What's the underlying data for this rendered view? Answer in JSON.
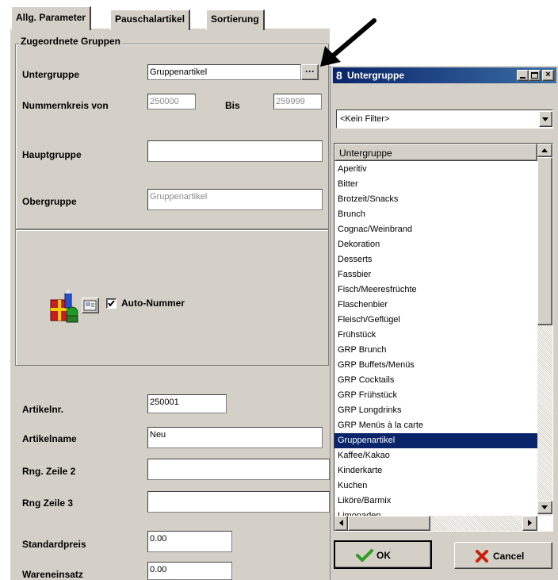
{
  "tabs": [
    {
      "label": "Allg. Parameter",
      "active": true
    },
    {
      "label": "Pauschalartikel",
      "active": false
    },
    {
      "label": "Sortierung",
      "active": false
    }
  ],
  "group_section": {
    "title": "Zugeordnete Gruppen",
    "untergruppe_label": "Untergruppe",
    "untergruppe_value": "Gruppenartikel",
    "browse_label": "···",
    "nummernkreis_label": "Nummernkreis von",
    "nummernkreis_von": "250000",
    "bis_label": "Bis",
    "nummernkreis_bis": "259999",
    "hauptgruppe_label": "Hauptgruppe",
    "hauptgruppe_value": "",
    "obergruppe_label": "Obergruppe",
    "obergruppe_value": "Gruppenartikel"
  },
  "auto_nummer": {
    "label": "Auto-Nummer",
    "checked": true
  },
  "article": {
    "artikelnr_label": "Artikelnr.",
    "artikelnr_value": "250001",
    "artikelname_label": "Artikelname",
    "artikelname_value": "Neu",
    "zeile2_label": "Rng. Zeile 2",
    "zeile2_value": "",
    "zeile3_label": "Rng Zeile 3",
    "zeile3_value": "",
    "standardpreis_label": "Standardpreis",
    "standardpreis_value": "0.00",
    "wareneinsatz_label": "Wareneinsatz",
    "wareneinsatz_value": "0.00"
  },
  "popup": {
    "title": "Untergruppe",
    "filter_value": "<Kein Filter>",
    "column_header": "Untergruppe",
    "items": [
      "Aperitiv",
      "Bitter",
      "Brotzeit/Snacks",
      "Brunch",
      "Cognac/Weinbrand",
      "Dekoration",
      "Desserts",
      "Fassbier",
      "Fisch/Meeresfrüchte",
      "Flaschenbier",
      "Fleisch/Geflügel",
      "Frühstück",
      "GRP Brunch",
      "GRP Buffets/Menüs",
      "GRP Cocktails",
      "GRP Frühstück",
      "GRP Longdrinks",
      "GRP Menüs à la carte",
      "Gruppenartikel",
      "Kaffee/Kakao",
      "Kinderkarte",
      "Kuchen",
      "Liköre/Barmix",
      "Limonaden"
    ],
    "selected_item": "Gruppenartikel",
    "ok_label": "OK",
    "cancel_label": "Cancel"
  },
  "colors": {
    "selection": "#0a246a",
    "window_face": "#d4d0c8",
    "ok_check": "#2f9e1f",
    "cancel_x": "#c81e0a"
  }
}
